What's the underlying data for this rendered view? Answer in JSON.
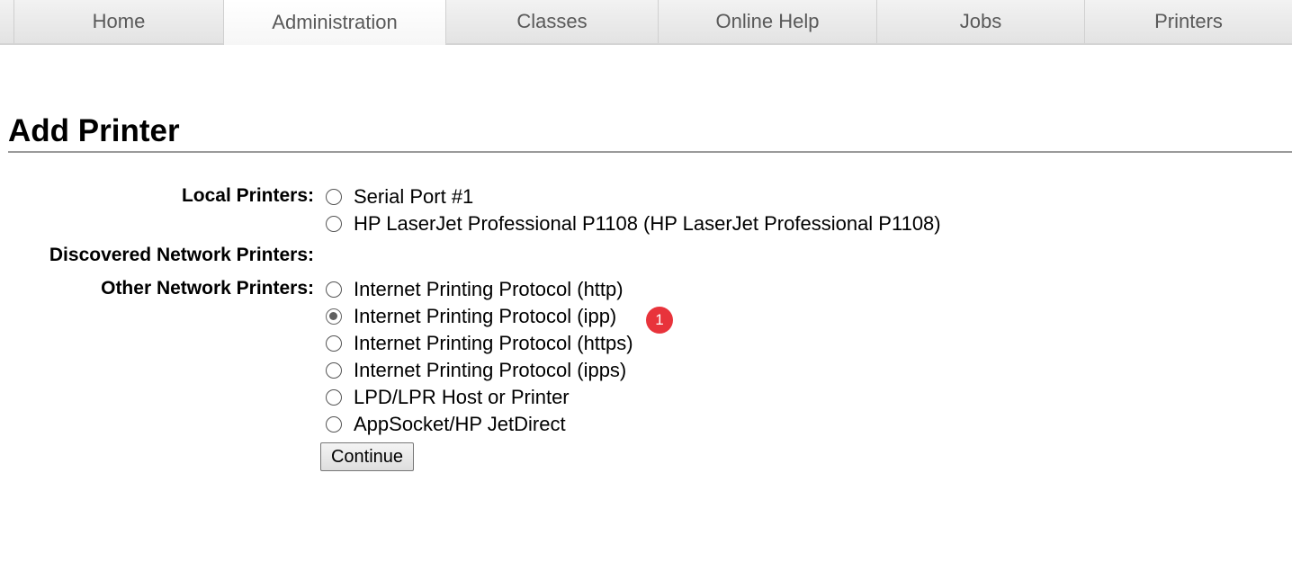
{
  "tabs": [
    {
      "label": "Home",
      "active": false
    },
    {
      "label": "Administration",
      "active": true
    },
    {
      "label": "Classes",
      "active": false
    },
    {
      "label": "Online Help",
      "active": false
    },
    {
      "label": "Jobs",
      "active": false
    },
    {
      "label": "Printers",
      "active": false
    }
  ],
  "page_title": "Add Printer",
  "sections": {
    "local_label": "Local Printers:",
    "discovered_label": "Discovered Network Printers:",
    "other_label": "Other Network Printers:"
  },
  "local_printers": [
    {
      "label": "Serial Port #1",
      "checked": false
    },
    {
      "label": "HP LaserJet Professional P1108 (HP LaserJet Professional P1108)",
      "checked": false
    }
  ],
  "other_printers": [
    {
      "label": "Internet Printing Protocol (http)",
      "checked": false
    },
    {
      "label": "Internet Printing Protocol (ipp)",
      "checked": true
    },
    {
      "label": "Internet Printing Protocol (https)",
      "checked": false
    },
    {
      "label": "Internet Printing Protocol (ipps)",
      "checked": false
    },
    {
      "label": "LPD/LPR Host or Printer",
      "checked": false
    },
    {
      "label": "AppSocket/HP JetDirect",
      "checked": false
    }
  ],
  "annotation_badge": "1",
  "continue_label": "Continue",
  "colors": {
    "badge": "#e8333b",
    "tab_text": "#595959"
  }
}
